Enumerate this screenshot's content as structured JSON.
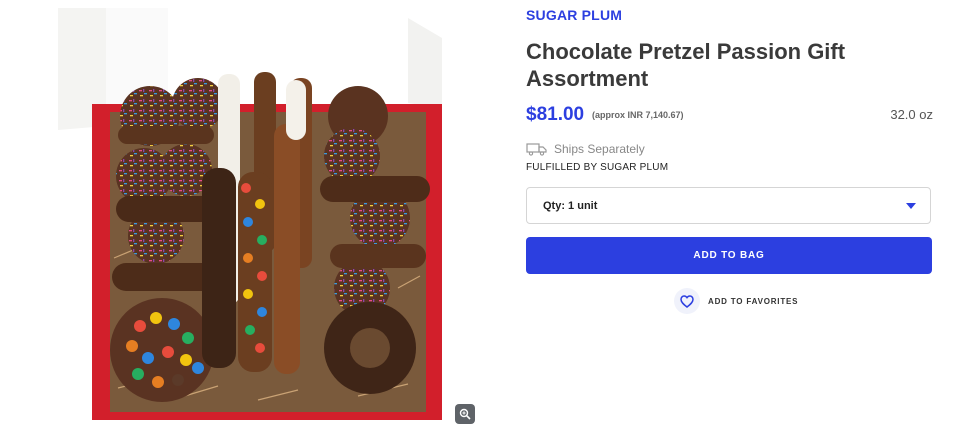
{
  "product_image": {
    "alt_icon": "product-photo"
  },
  "zoom": {
    "icon": "zoom-icon"
  },
  "brand": "SUGAR PLUM",
  "title": "Chocolate Pretzel Passion Gift Assortment",
  "price": "$81.00",
  "price_approx": "(approx INR 7,140.67)",
  "weight": "32.0 oz",
  "shipping": {
    "icon": "truck-icon",
    "text": "Ships Separately"
  },
  "fulfilled_by": "FULFILLED BY SUGAR PLUM",
  "quantity": {
    "selected": "Qty: 1 unit",
    "icon": "caret-down-icon"
  },
  "add_to_bag_label": "ADD TO BAG",
  "favorites": {
    "icon": "heart-icon",
    "label": "ADD TO FAVORITES"
  },
  "colors": {
    "accent": "#2c3fe0",
    "box_red": "#d21f2b"
  }
}
